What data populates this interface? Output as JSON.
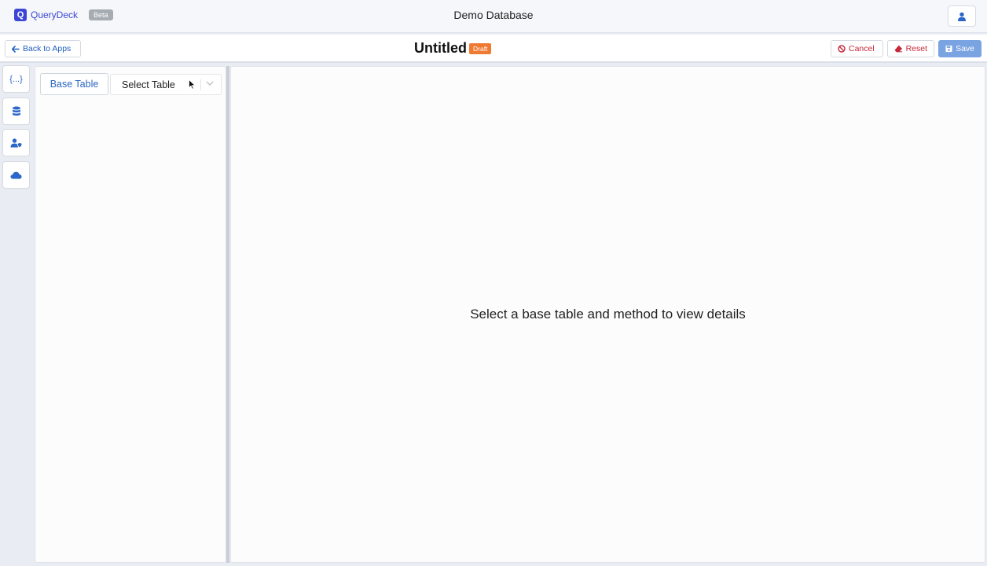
{
  "header": {
    "brand_letter": "Q",
    "brand_name": "QueryDeck",
    "badge": "Beta",
    "database_title": "Demo Database",
    "user_icon": "user-icon"
  },
  "toolbar": {
    "back_label": "Back to Apps",
    "page_title": "Untitled",
    "status_badge": "Draft",
    "cancel_label": "Cancel",
    "reset_label": "Reset",
    "save_label": "Save"
  },
  "rail": {
    "items": [
      {
        "icon": "json-braces-icon",
        "label": "{...}"
      },
      {
        "icon": "database-icon"
      },
      {
        "icon": "user-shield-icon"
      },
      {
        "icon": "cloud-icon"
      }
    ]
  },
  "left_panel": {
    "tab_label": "Base Table",
    "select_value": "Select Table"
  },
  "main": {
    "empty_message": "Select a base table and method to view details"
  },
  "colors": {
    "brand": "#3b46d6",
    "link": "#1f5fbf",
    "danger": "#c6283a",
    "draft": "#ef7a32",
    "save": "#7aa3e2"
  }
}
